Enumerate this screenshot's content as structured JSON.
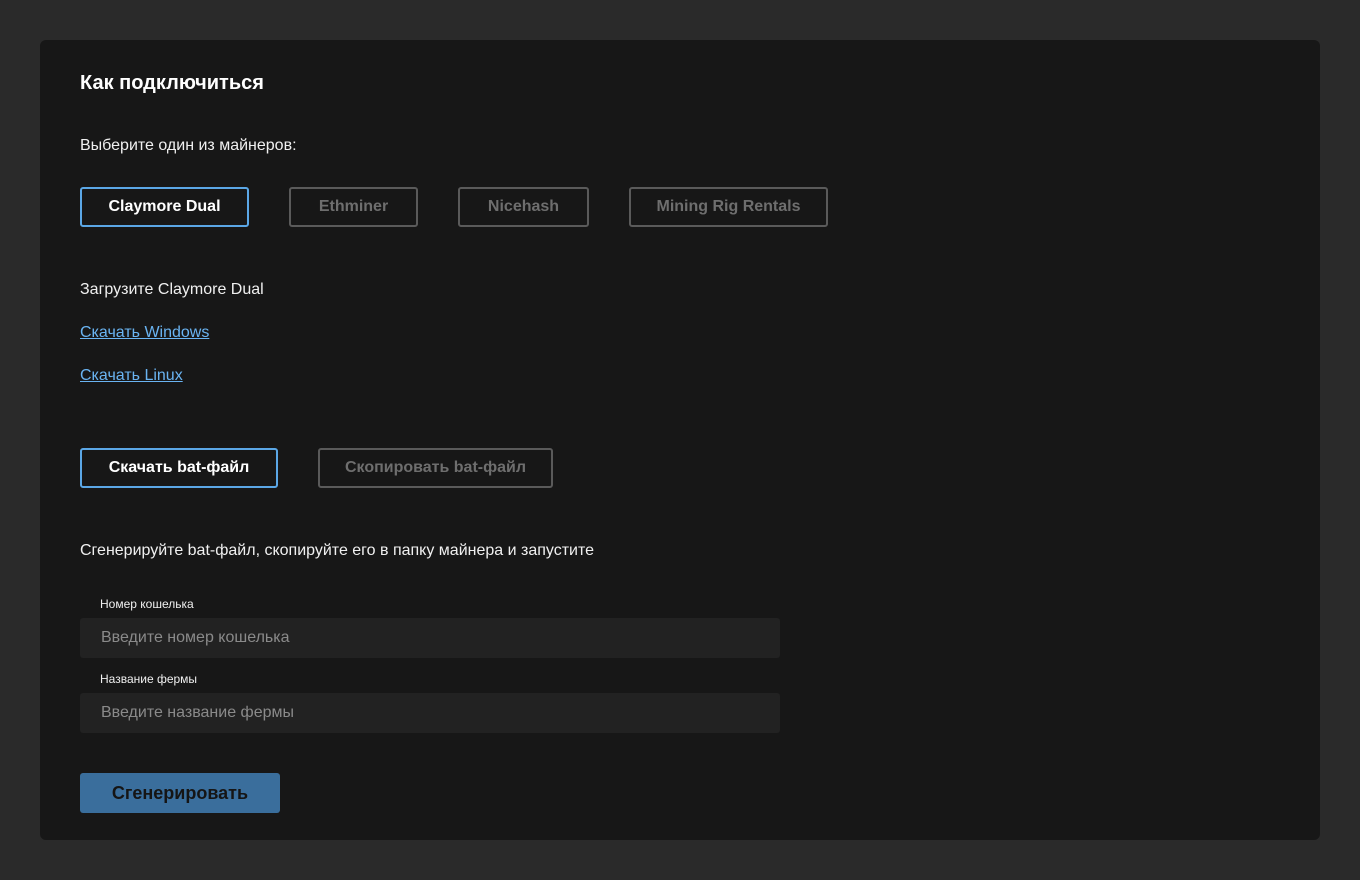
{
  "page": {
    "title": "Как подключиться",
    "prompt": "Выберите один из майнеров:"
  },
  "miners": [
    {
      "label": "Claymore Dual",
      "active": true
    },
    {
      "label": "Ethminer",
      "active": false
    },
    {
      "label": "Nicehash",
      "active": false
    },
    {
      "label": "Mining Rig Rentals",
      "active": false
    }
  ],
  "download": {
    "title": "Загрузите Claymore Dual",
    "windows_link": "Скачать Windows",
    "linux_link": "Скачать Linux"
  },
  "bat_actions": {
    "download_label": "Скачать bat-файл",
    "copy_label": "Скопировать bat-файл"
  },
  "instruction": "Сгенерируйте bat-файл, скопируйте его в папку майнера и запустите",
  "form": {
    "wallet_label": "Номер кошелька",
    "wallet_value": "",
    "wallet_placeholder": "Введите номер кошелька",
    "farm_label": "Название фермы",
    "farm_value": "",
    "farm_placeholder": "Введите название фермы",
    "submit_label": "Сгенерировать"
  },
  "colors": {
    "accent": "#5ba7e6",
    "link": "#6ab4f2",
    "submit_bg": "#3a6e9c"
  }
}
